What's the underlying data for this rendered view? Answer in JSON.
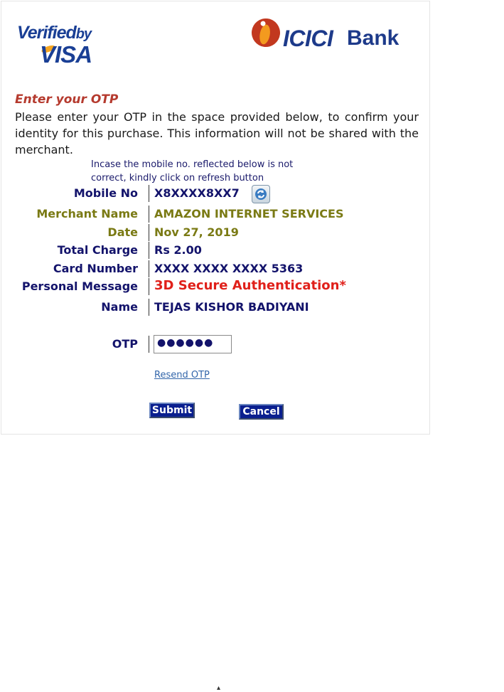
{
  "logos": {
    "vbv_line1": "Verified",
    "vbv_by": "by",
    "vbv_visa": "VISA",
    "bank_name": "ICICI",
    "bank_suffix": "Bank"
  },
  "heading": "Enter your OTP",
  "instructions": "Please enter your OTP in the space provided below, to confirm your identity for this purchase. This information will not be shared with the merchant.",
  "refresh_note": "Incase the mobile no. reflected below is not correct, kindly click on refresh button",
  "fields": [
    {
      "label": "Mobile No",
      "value": "X8XXXX8XX7"
    },
    {
      "label": "Merchant Name",
      "value": "AMAZON INTERNET SERVICES"
    },
    {
      "label": "Date",
      "value": "Nov 27, 2019"
    },
    {
      "label": "Total Charge",
      "value": "Rs 2.00"
    },
    {
      "label": "Card Number",
      "value": "XXXX XXXX XXXX 5363"
    },
    {
      "label": "Personal Message",
      "value": "3D Secure Authentication*"
    },
    {
      "label": "Name",
      "value": "TEJAS KISHOR BADIYANI"
    }
  ],
  "otp": {
    "label": "OTP",
    "masked_value": "●●●●●●"
  },
  "resend_label": "Resend OTP",
  "buttons": {
    "submit": "Submit",
    "cancel": "Cancel"
  },
  "colors": {
    "label_navy": "#13136b",
    "label_olive": "#7a7a14",
    "heading_red": "#b53a2e",
    "message_red": "#e0201a",
    "button_blue": "#0a1f8f"
  },
  "icons": {
    "refresh": "refresh-icon"
  }
}
